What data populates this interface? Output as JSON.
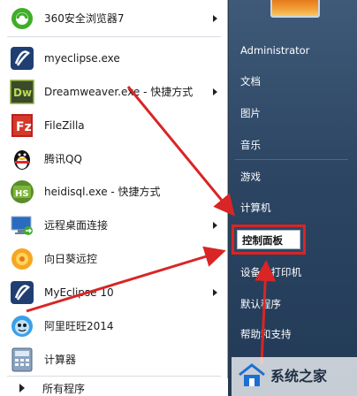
{
  "programs": [
    {
      "label": "360安全浏览器7",
      "icon": "360-browser-icon",
      "submenu": true
    },
    {
      "label": "myeclipse.exe",
      "icon": "myeclipse-icon",
      "submenu": false
    },
    {
      "label": "Dreamweaver.exe - 快捷方式",
      "icon": "dreamweaver-icon",
      "submenu": true
    },
    {
      "label": "FileZilla",
      "icon": "filezilla-icon",
      "submenu": false
    },
    {
      "label": "腾讯QQ",
      "icon": "qq-penguin-icon",
      "submenu": false
    },
    {
      "label": "heidisql.exe - 快捷方式",
      "icon": "heidisql-icon",
      "submenu": false
    },
    {
      "label": "远程桌面连接",
      "icon": "remote-desktop-icon",
      "submenu": true
    },
    {
      "label": "向日葵远控",
      "icon": "sunflower-icon",
      "submenu": false
    },
    {
      "label": "MyEclipse 10",
      "icon": "myeclipse-10-icon",
      "submenu": true
    },
    {
      "label": "阿里旺旺2014",
      "icon": "aliwangwang-icon",
      "submenu": false
    },
    {
      "label": "计算器",
      "icon": "calculator-icon",
      "submenu": false
    }
  ],
  "all_programs": "所有程序",
  "right_items": {
    "user": "Administrator",
    "documents": "文档",
    "pictures": "图片",
    "music": "音乐",
    "games": "游戏",
    "computer": "计算机",
    "control_panel": "控制面板",
    "devices_printers": "设备和打印机",
    "default_programs": "默认程序",
    "help_support": "帮助和支持"
  },
  "watermark": {
    "text": "系统之家"
  },
  "colors": {
    "annotation_red": "#d92525",
    "right_panel_top": "#3f5a78",
    "right_panel_bottom": "#223a56"
  }
}
